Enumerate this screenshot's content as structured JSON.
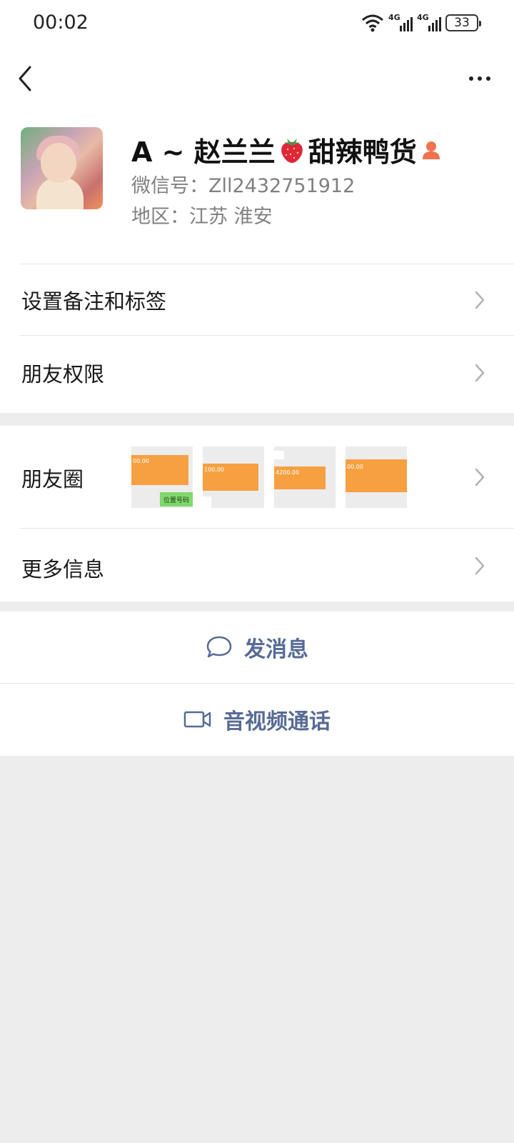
{
  "status_bar": {
    "time": "00:02",
    "network_labels": [
      "4G",
      "4G"
    ],
    "battery_level": "33",
    "icons": [
      "wifi-icon",
      "signal-4g-icon",
      "signal-4g-icon",
      "battery-icon"
    ]
  },
  "top_bar": {
    "back_icon": "chevron-left-icon",
    "more_icon": "more-dots-icon"
  },
  "profile": {
    "nickname_prefix": "A ~ 赵兰兰",
    "nickname_suffix": "甜辣鸭货",
    "emoji_icon": "strawberry-icon",
    "badge_icon": "person-badge-icon",
    "wechat_id": "微信号：Zll2432751912",
    "region": "地区：江苏  淮安"
  },
  "rows": {
    "remark_label": "设置备注和标签",
    "permission_label": "朋友权限",
    "moments_label": "朋友圈",
    "more_info_label": "更多信息"
  },
  "moments_thumbnails": [
    {
      "amount": "00.00",
      "tag": "位置号码"
    },
    {
      "amount": "100.00",
      "tag": ""
    },
    {
      "amount": "4200.00",
      "tag": ""
    },
    {
      "amount": "00.00",
      "tag": ""
    }
  ],
  "actions": {
    "message_label": "发消息",
    "message_icon": "chat-bubble-icon",
    "call_label": "音视频通话",
    "call_icon": "video-camera-icon"
  },
  "colors": {
    "link_blue": "#576b95",
    "background": "#ededed",
    "thumbnail_orange": "#f6a042"
  }
}
